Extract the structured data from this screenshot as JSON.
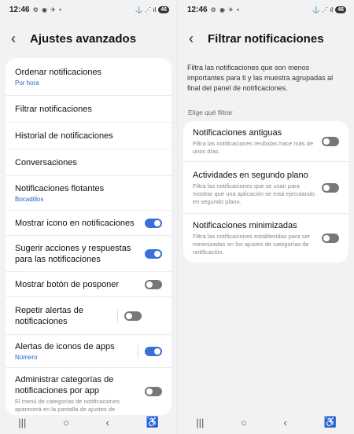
{
  "status": {
    "time": "12:46",
    "icons": "⚙ ◉ ✈ •",
    "signal": "⚓ ⋰ ıl",
    "battery": "46"
  },
  "left": {
    "title": "Ajustes avanzados",
    "items": [
      {
        "title": "Ordenar notificaciones",
        "sub": "Por hora"
      },
      {
        "title": "Filtrar notificaciones"
      },
      {
        "title": "Historial de notificaciones"
      },
      {
        "title": "Conversaciones"
      },
      {
        "title": "Notificaciones flotantes",
        "sub": "Bocadillos"
      },
      {
        "title": "Mostrar icono en notificaciones",
        "toggle": "on"
      },
      {
        "title": "Sugerir acciones y respuestas para las notificaciones",
        "toggle": "on"
      },
      {
        "title": "Mostrar botón de posponer",
        "toggle": "off"
      },
      {
        "title": "Repetir alertas de notificaciones",
        "toggle": "off"
      },
      {
        "title": "Alertas de iconos de apps",
        "sub": "Número",
        "toggle": "on"
      },
      {
        "title": "Administrar categorías de notificaciones por app",
        "desc": "El menú de categorías de notificaciones aparecerá en la pantalla de ajustes de notificaciones de cada aplicación.",
        "toggle": "off"
      }
    ]
  },
  "right": {
    "title": "Filtrar notificaciones",
    "intro": "Filtra las notificaciones que son menos importantes para ti y las muestra agrupadas al final del panel de notificaciones.",
    "section": "Elige qué filtrar",
    "items": [
      {
        "title": "Notificaciones antiguas",
        "desc": "Filtra las notificaciones recibidas hace más de unos días.",
        "toggle": "off"
      },
      {
        "title": "Actividades en segundo plano",
        "desc": "Filtra las notificaciones que se usan para mostrar que una aplicación se está ejecutando en segundo plano.",
        "toggle": "off"
      },
      {
        "title": "Notificaciones minimizadas",
        "desc": "Filtra las notificaciones establecidas para ser minimizadas en los ajustes de categorías de notificación.",
        "toggle": "off"
      }
    ]
  },
  "nav": {
    "recents": "|||",
    "home": "○",
    "back": "‹",
    "accessibility": "♿"
  }
}
